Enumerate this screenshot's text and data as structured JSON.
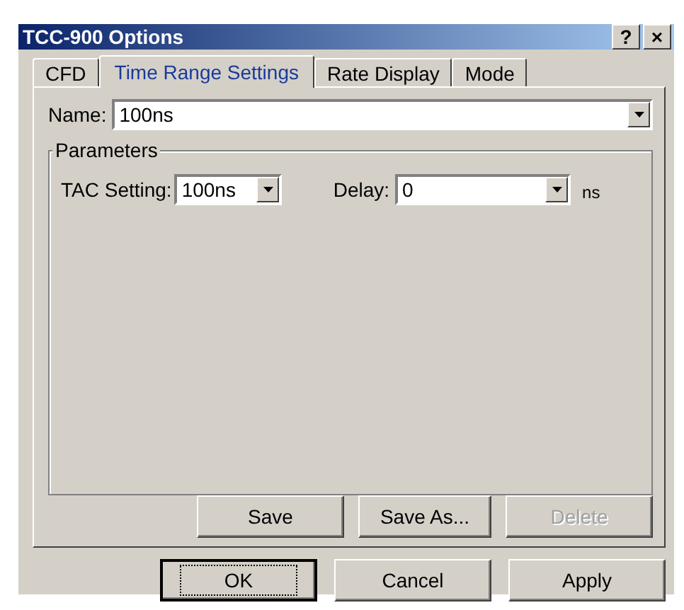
{
  "window": {
    "title": "TCC-900 Options",
    "help_button": "?",
    "close_button": "×"
  },
  "tabs": [
    {
      "label": "CFD",
      "selected": false
    },
    {
      "label": "Time Range Settings",
      "selected": true
    },
    {
      "label": "Rate Display",
      "selected": false
    },
    {
      "label": "Mode",
      "selected": false
    }
  ],
  "name_field": {
    "label": "Name:",
    "value": "100ns"
  },
  "parameters": {
    "title": "Parameters",
    "tac_setting": {
      "label": "TAC Setting:",
      "value": "100ns"
    },
    "delay": {
      "label": "Delay:",
      "value": "0",
      "unit": "ns"
    }
  },
  "panel_buttons": [
    {
      "label": "Save",
      "disabled": false
    },
    {
      "label": "Save As...",
      "disabled": false
    },
    {
      "label": "Delete",
      "disabled": true
    }
  ],
  "dialog_buttons": [
    {
      "label": "OK",
      "default": true
    },
    {
      "label": "Cancel",
      "default": false
    },
    {
      "label": "Apply",
      "default": false
    }
  ]
}
